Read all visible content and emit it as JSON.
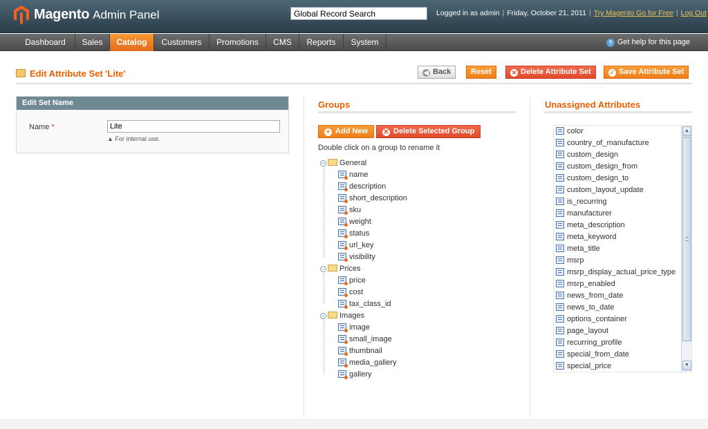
{
  "header": {
    "logo_brand": "Magento",
    "logo_sub": "Admin Panel",
    "search_value": "Global Record Search",
    "logged_in": "Logged in as admin",
    "date": "Friday, October 21, 2011",
    "try_link": "Try Magento Go for Free",
    "logout": "Log Out"
  },
  "nav": {
    "items": [
      "Dashboard",
      "Sales",
      "Catalog",
      "Customers",
      "Promotions",
      "CMS",
      "Reports",
      "System"
    ],
    "active": "Catalog",
    "help": "Get help for this page"
  },
  "page": {
    "title": "Edit Attribute Set 'Lite'",
    "buttons": {
      "back": "Back",
      "reset": "Reset",
      "delete": "Delete Attribute Set",
      "save": "Save Attribute Set"
    }
  },
  "set_name": {
    "heading": "Edit Set Name",
    "label": "Name",
    "required_mark": "*",
    "value": "Lite",
    "note": "For internal use."
  },
  "groups": {
    "title": "Groups",
    "add_new": "Add New",
    "delete_selected": "Delete Selected Group",
    "hint": "Double click on a group to rename it",
    "tree": [
      {
        "name": "General",
        "items": [
          "name",
          "description",
          "short_description",
          "sku",
          "weight",
          "status",
          "url_key",
          "visibility"
        ]
      },
      {
        "name": "Prices",
        "items": [
          "price",
          "cost",
          "tax_class_id"
        ]
      },
      {
        "name": "Images",
        "items": [
          "image",
          "small_image",
          "thumbnail",
          "media_gallery",
          "gallery"
        ]
      }
    ]
  },
  "unassigned": {
    "title": "Unassigned Attributes",
    "items": [
      "color",
      "country_of_manufacture",
      "custom_design",
      "custom_design_from",
      "custom_design_to",
      "custom_layout_update",
      "is_recurring",
      "manufacturer",
      "meta_description",
      "meta_keyword",
      "meta_title",
      "msrp",
      "msrp_display_actual_price_type",
      "msrp_enabled",
      "news_from_date",
      "news_to_date",
      "options_container",
      "page_layout",
      "recurring_profile",
      "special_from_date",
      "special_price"
    ]
  },
  "colors": {
    "accent": "#eb5e00",
    "header": "#2a3d48",
    "nav_active": "#f08a2b"
  }
}
